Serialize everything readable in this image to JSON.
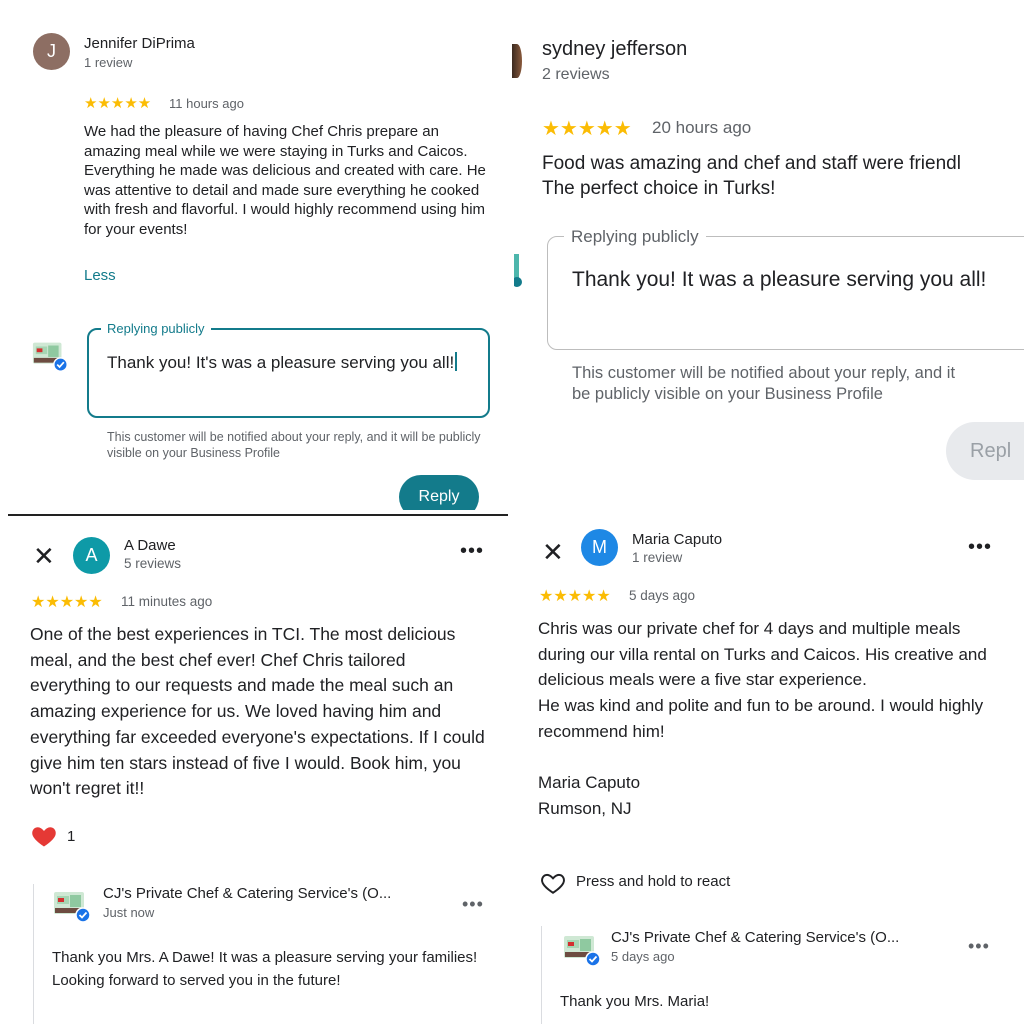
{
  "colors": {
    "accent": "#137b8b",
    "star": "#fbbc04",
    "heart": "#e53935",
    "muted": "#5f6368"
  },
  "panel1": {
    "avatar_letter": "J",
    "reviewer_name": "Jennifer DiPrima",
    "review_count": "1 review",
    "stars": "★★★★★",
    "time": "11 hours ago",
    "review_text": "We had the pleasure of having Chef Chris prepare an amazing meal while we were staying in Turks and Caicos. Everything he made was delicious and created with care. He was attentive to detail and made sure everything he cooked with fresh and flavorful. I would highly recommend using him for your events!",
    "less_link": "Less",
    "reply_legend": "Replying publicly",
    "reply_value": "Thank you! It's was a pleasure serving you all!",
    "notice": "This customer will be notified about your reply, and it will be publicly visible on your Business Profile",
    "reply_button": "Reply"
  },
  "panel2": {
    "reviewer_name": "sydney jefferson",
    "review_count": "2 reviews",
    "stars": "★★★★★",
    "time": "20 hours ago",
    "review_line1": "Food was amazing and chef and staff were friendl",
    "review_line2": "The perfect choice in Turks!",
    "reply_legend": "Replying publicly",
    "reply_value": "Thank you! It was a pleasure serving you all!",
    "notice_line1": "This customer will be notified about your reply, and it",
    "notice_line2": "be publicly visible on your Business Profile",
    "reply_button": "Repl"
  },
  "panel3": {
    "close_icon": "close-icon",
    "avatar_letter": "A",
    "reviewer_name": "A Dawe",
    "review_count": "5 reviews",
    "stars": "★★★★★",
    "time": "11 minutes ago",
    "review_text": "One of the best experiences in TCI. The most delicious meal, and the best chef ever! Chef Chris tailored everything to our requests and made the meal such an amazing experience for us. We loved having him and everything far exceeded everyone's expectations. If I could give him ten stars instead of five I would. Book him, you won't regret it!!",
    "reaction_count": "1",
    "business_name": "CJ's Private Chef & Catering Service's (O...",
    "business_time": "Just now",
    "business_reply": "Thank you Mrs. A Dawe! It was a pleasure serving your families!  Looking forward to served you in the future!"
  },
  "panel4": {
    "close_icon": "close-icon",
    "avatar_letter": "M",
    "reviewer_name": "Maria Caputo",
    "review_count": "1 review",
    "stars": "★★★★★",
    "time": "5 days ago",
    "review_text": "Chris was our private chef for 4 days and multiple meals during our villa rental on Turks and Caicos. His creative and delicious meals were a five star experience.\nHe was kind and polite and fun to be around. I would highly recommend him!\n\nMaria Caputo\nRumson, NJ",
    "react_label": "Press and hold to react",
    "business_name": "CJ's Private Chef & Catering Service's (O...",
    "business_time": "5 days ago",
    "business_reply": "Thank you Mrs. Maria!"
  }
}
